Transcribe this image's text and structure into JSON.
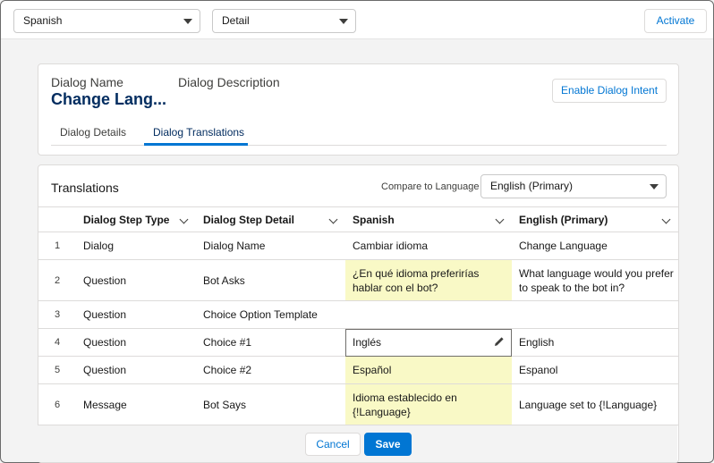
{
  "topbar": {
    "language_select": "Spanish",
    "view_select": "Detail",
    "activate_label": "Activate"
  },
  "header": {
    "dialog_name_label": "Dialog Name",
    "dialog_name_value": "Change Lang...",
    "dialog_description_label": "Dialog Description",
    "enable_intent_label": "Enable Dialog Intent",
    "tabs": [
      {
        "label": "Dialog Details"
      },
      {
        "label": "Dialog Translations"
      }
    ]
  },
  "translations": {
    "title": "Translations",
    "compare_label": "Compare to Language",
    "compare_select": "English (Primary)",
    "columns": [
      "Dialog Step Type",
      "Dialog Step Detail",
      "Spanish",
      "English (Primary)"
    ],
    "rows": [
      {
        "num": "1",
        "type": "Dialog",
        "detail": "Dialog Name",
        "spanish": "Cambiar idioma",
        "english": "Change Language"
      },
      {
        "num": "2",
        "type": "Question",
        "detail": "Bot Asks",
        "spanish": "¿En qué idioma preferirías hablar con el bot?",
        "english": "What language would you prefer to speak to the bot in?"
      },
      {
        "num": "3",
        "type": "Question",
        "detail": "Choice Option Template",
        "spanish": "",
        "english": ""
      },
      {
        "num": "4",
        "type": "Question",
        "detail": "Choice #1",
        "spanish": "Inglés",
        "english": "English"
      },
      {
        "num": "5",
        "type": "Question",
        "detail": "Choice #2",
        "spanish": "Español",
        "english": "Espanol"
      },
      {
        "num": "6",
        "type": "Message",
        "detail": "Bot Says",
        "spanish": "Idioma establecido en {!Language}",
        "english": "Language set to {!Language}"
      }
    ]
  },
  "footer": {
    "cancel_label": "Cancel",
    "save_label": "Save"
  },
  "colors": {
    "brand_blue": "#0176d3",
    "highlight_yellow": "#f9f9c6",
    "title_navy": "#032d60"
  }
}
